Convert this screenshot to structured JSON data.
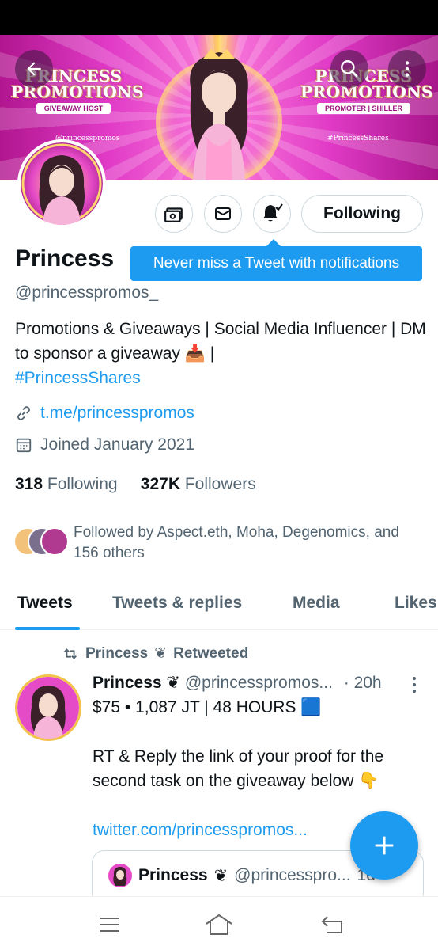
{
  "banner": {
    "left_brand": "PRINCESS PROMOTIONS",
    "left_tag": "GIVEAWAY HOST",
    "left_handle": "@princesspromos",
    "right_brand": "PRINCESS PROMOTIONS",
    "right_tag": "PROMOTER | SHILLER",
    "right_hashtag": "#PrincessShares"
  },
  "header": {
    "back_icon": "arrow-left-icon",
    "search_icon": "search-icon",
    "more_icon": "more-vertical-icon"
  },
  "profile": {
    "display_name": "Princess",
    "handle": "@princesspromos_",
    "bio_text": "Promotions & Giveaways | Social Media Influencer | DM to sponsor a giveaway 📥 |",
    "bio_hashtag": "#PrincessShares",
    "link": "t.me/princesspromos",
    "joined": "Joined January 2021",
    "following_count": "318",
    "following_label": "Following",
    "followers_count": "327K",
    "followers_label": "Followers",
    "followed_by": "Followed by Aspect.eth, Moha, Degenomics, and 156 others"
  },
  "actions": {
    "following_button": "Following",
    "tooltip": "Never miss a Tweet with notifications"
  },
  "tabs": [
    "Tweets",
    "Tweets & replies",
    "Media",
    "Likes"
  ],
  "tweet": {
    "retweeted_by": "Princess",
    "retweeted_label": "Retweeted",
    "author": "Princess",
    "author_handle": "@princesspromos...",
    "time": "· 20h",
    "line1": "$75 • 1,087 JT | 48 HOURS 🟦",
    "line2": "RT & Reply the link of your proof for the second task on the giveaway below 👇",
    "link": "twitter.com/princesspromos...",
    "quote_author": "Princess",
    "quote_handle": "@princesspro...",
    "quote_time": "1d"
  },
  "colors": {
    "accent": "#1d9bf0",
    "text": "#0f1419",
    "muted": "#536471"
  }
}
